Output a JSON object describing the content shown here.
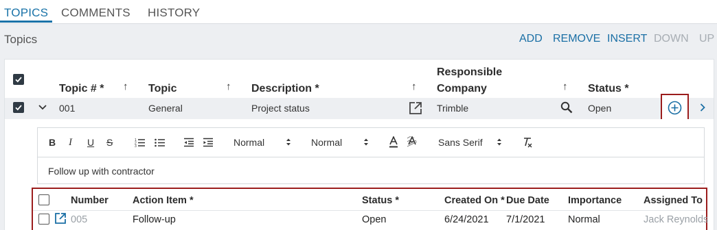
{
  "tabs": [
    {
      "label": "TOPICS",
      "active": true
    },
    {
      "label": "COMMENTS",
      "active": false
    },
    {
      "label": "HISTORY",
      "active": false
    }
  ],
  "section": {
    "title": "Topics",
    "actions": [
      {
        "label": "ADD",
        "enabled": true
      },
      {
        "label": "REMOVE",
        "enabled": true
      },
      {
        "label": "INSERT",
        "enabled": true
      },
      {
        "label": "DOWN",
        "enabled": false
      },
      {
        "label": "UP",
        "enabled": false
      }
    ]
  },
  "topics_table": {
    "columns": {
      "topic_number": "Topic # *",
      "topic": "Topic",
      "description": "Description *",
      "responsible_line1": "Responsible",
      "responsible_line2": "Company",
      "status": "Status *"
    },
    "sort_glyph": "↑",
    "row": {
      "number": "001",
      "topic": "General",
      "description": "Project status",
      "responsible_company": "Trimble",
      "status": "Open"
    }
  },
  "editor": {
    "format_1": "Normal",
    "format_2": "Normal",
    "font": "Sans Serif",
    "content": "Follow up with contractor"
  },
  "action_items": {
    "columns": {
      "number": "Number",
      "action_item": "Action Item *",
      "status": "Status *",
      "created_on": "Created On *",
      "due_date": "Due Date",
      "importance": "Importance",
      "assigned_to": "Assigned To"
    },
    "rows": [
      {
        "number": "005",
        "action_item": "Follow-up",
        "status": "Open",
        "created_on": "6/24/2021",
        "due_date": "7/1/2021",
        "importance": "Normal",
        "assigned_to": "Jack Reynolds"
      }
    ]
  },
  "colors": {
    "accent": "#1a73a8",
    "highlight": "#9b1c1c",
    "disabled": "#a7adb3"
  }
}
